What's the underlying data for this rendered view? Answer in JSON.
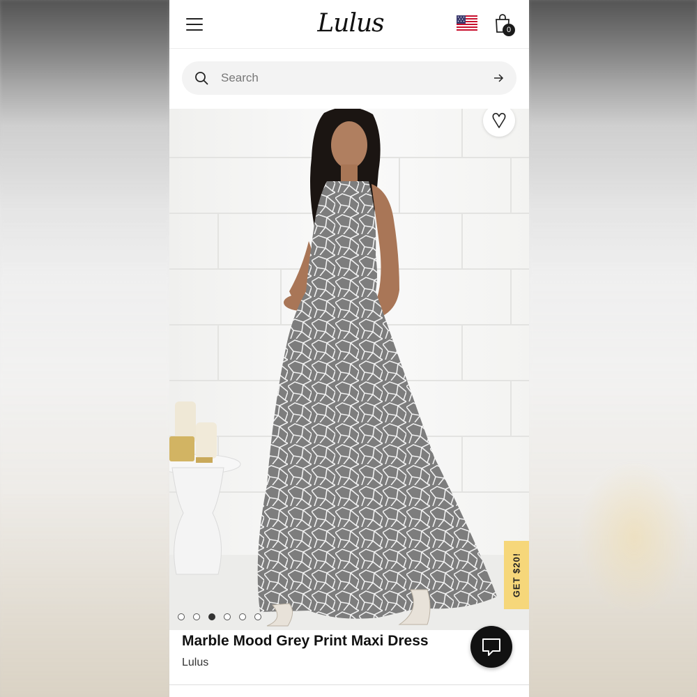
{
  "header": {
    "logo_text": "Lulus",
    "menu_icon": "hamburger-menu-icon",
    "flag_icon": "us-flag-icon",
    "cart_icon": "shopping-bag-icon",
    "cart_count": "0"
  },
  "search": {
    "placeholder": "Search",
    "search_icon": "search-icon",
    "submit_icon": "arrow-right-icon"
  },
  "gallery": {
    "wishlist_icon": "heart-icon",
    "promo_label": "GET $20!",
    "dots_total": 6,
    "active_dot": 3
  },
  "product": {
    "title": "Marble Mood Grey Print Maxi Dress",
    "brand": "Lulus"
  },
  "chat": {
    "icon": "chat-bubble-icon"
  },
  "colors": {
    "promo_yellow": "#f6d77a",
    "dress_grey": "#7a7a7a",
    "text_dark": "#111111"
  }
}
